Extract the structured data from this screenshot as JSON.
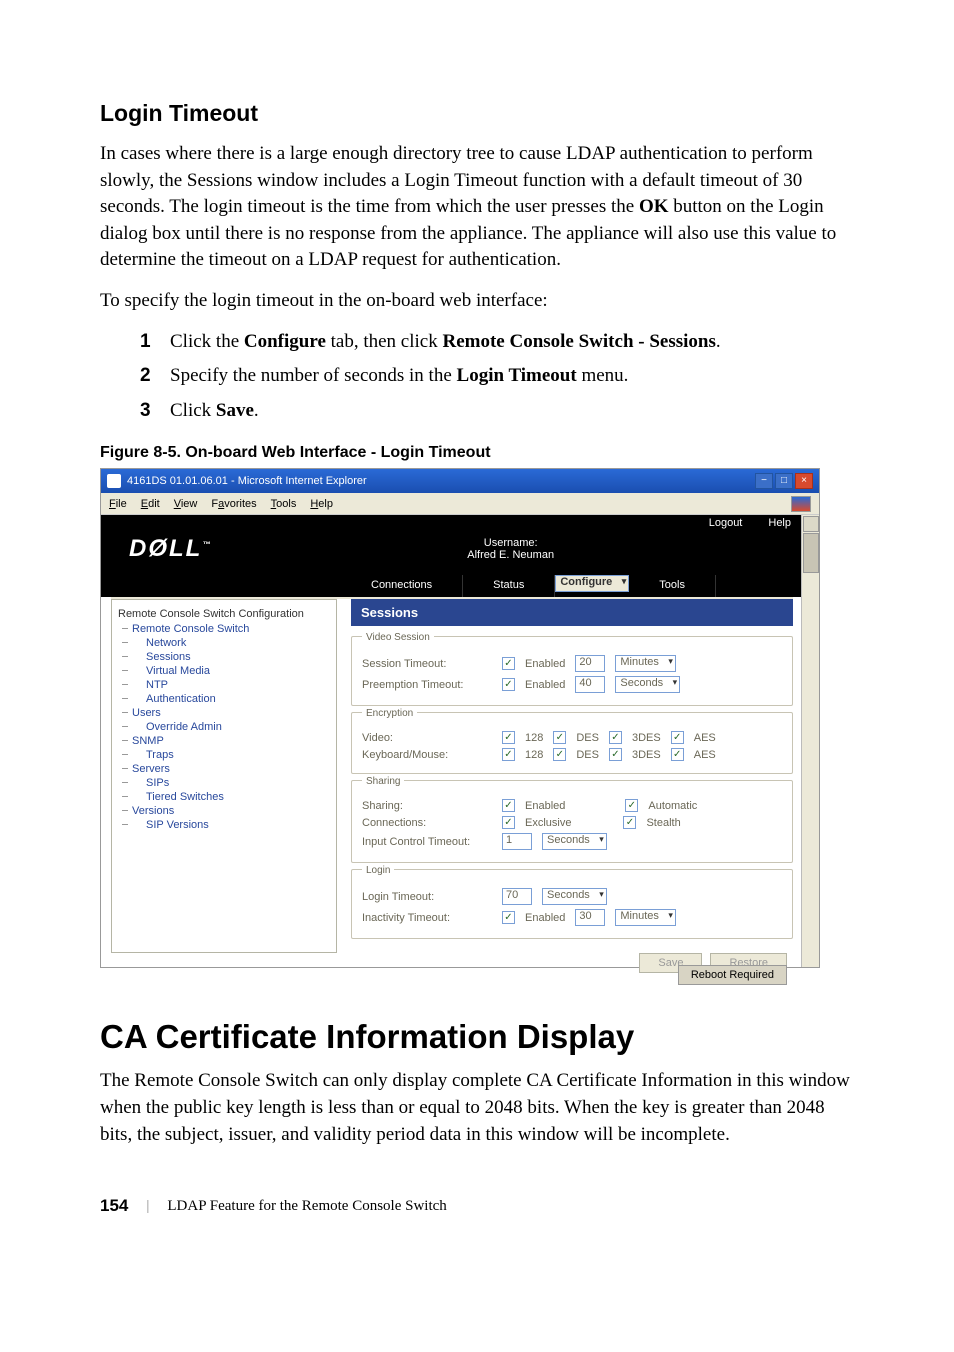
{
  "headings": {
    "login_timeout": "Login Timeout",
    "ca_cert": "CA Certificate Information Display"
  },
  "body": {
    "para1": "In cases where there is a large enough directory tree to cause LDAP authentication to perform slowly, the Sessions window includes a Login Timeout function with a default timeout of 30 seconds. The login timeout is the time from which the user presses the ",
    "para1_bold": "OK",
    "para1_tail": " button on the Login dialog box until there is no response from the appliance. The appliance will also use this value to determine the timeout on a LDAP request for authentication.",
    "para2": "To specify the login timeout in the on-board web interface:",
    "step1_a": "Click the ",
    "step1_b": "Configure",
    "step1_c": " tab, then click ",
    "step1_d": "Remote Console Switch - Sessions",
    "step1_e": ".",
    "step2_a": "Specify the number of seconds in the ",
    "step2_b": "Login Timeout",
    "step2_c": " menu.",
    "step3_a": "Click ",
    "step3_b": "Save",
    "step3_c": ".",
    "figure_caption": "Figure 8-5. On-board Web Interface - Login Timeout",
    "ca_para": "The Remote Console Switch can only display complete CA Certificate Information in this window when the public key length is less than or equal to 2048 bits. When the key is greater than 2048 bits, the subject, issuer, and validity period data in this window will be incomplete."
  },
  "footer": {
    "page": "154",
    "divider": "|",
    "text": "LDAP Feature for the Remote Console Switch"
  },
  "screenshot": {
    "titlebar": "4161DS 01.01.06.01 - Microsoft Internet Explorer",
    "menubar": {
      "file": "File",
      "edit": "Edit",
      "view": "View",
      "favorites": "Favorites",
      "tools": "Tools",
      "help": "Help"
    },
    "top": {
      "logout": "Logout",
      "help": "Help"
    },
    "masthead": {
      "logo": "DØLL",
      "username_label": "Username:",
      "username": "Alfred E. Neuman"
    },
    "tabs": {
      "connections": "Connections",
      "status": "Status",
      "configure": "Configure",
      "tools": "Tools"
    },
    "nav": {
      "title": "Remote Console Switch Configuration",
      "items": [
        "Remote Console Switch",
        "Network",
        "Sessions",
        "Virtual Media",
        "NTP",
        "Authentication",
        "Users",
        "Override Admin",
        "SNMP",
        "Traps",
        "Servers",
        "SIPs",
        "Tiered Switches",
        "Versions",
        "SIP Versions"
      ]
    },
    "panel_title": "Sessions",
    "groups": {
      "video_session": {
        "legend": "Video Session",
        "session_timeout": "Session Timeout:",
        "preemption_timeout": "Preemption Timeout:",
        "enabled": "Enabled",
        "minutes": "Minutes",
        "seconds": "Seconds",
        "val1": "20",
        "val2": "40"
      },
      "encryption": {
        "legend": "Encryption",
        "video": "Video:",
        "keyboard": "Keyboard/Mouse:",
        "c128": "128",
        "des": "DES",
        "tdes": "3DES",
        "aes": "AES"
      },
      "sharing": {
        "legend": "Sharing",
        "sharing": "Sharing:",
        "connections": "Connections:",
        "input_control": "Input Control Timeout:",
        "enabled": "Enabled",
        "automatic": "Automatic",
        "exclusive": "Exclusive",
        "stealth": "Stealth",
        "val": "1",
        "seconds": "Seconds"
      },
      "login": {
        "legend": "Login",
        "login_timeout": "Login Timeout:",
        "inactivity": "Inactivity Timeout:",
        "val1": "70",
        "val2": "30",
        "seconds": "Seconds",
        "enabled": "Enabled",
        "minutes": "Minutes"
      }
    },
    "buttons": {
      "save": "Save",
      "restore": "Restore",
      "reboot": "Reboot Required"
    }
  }
}
